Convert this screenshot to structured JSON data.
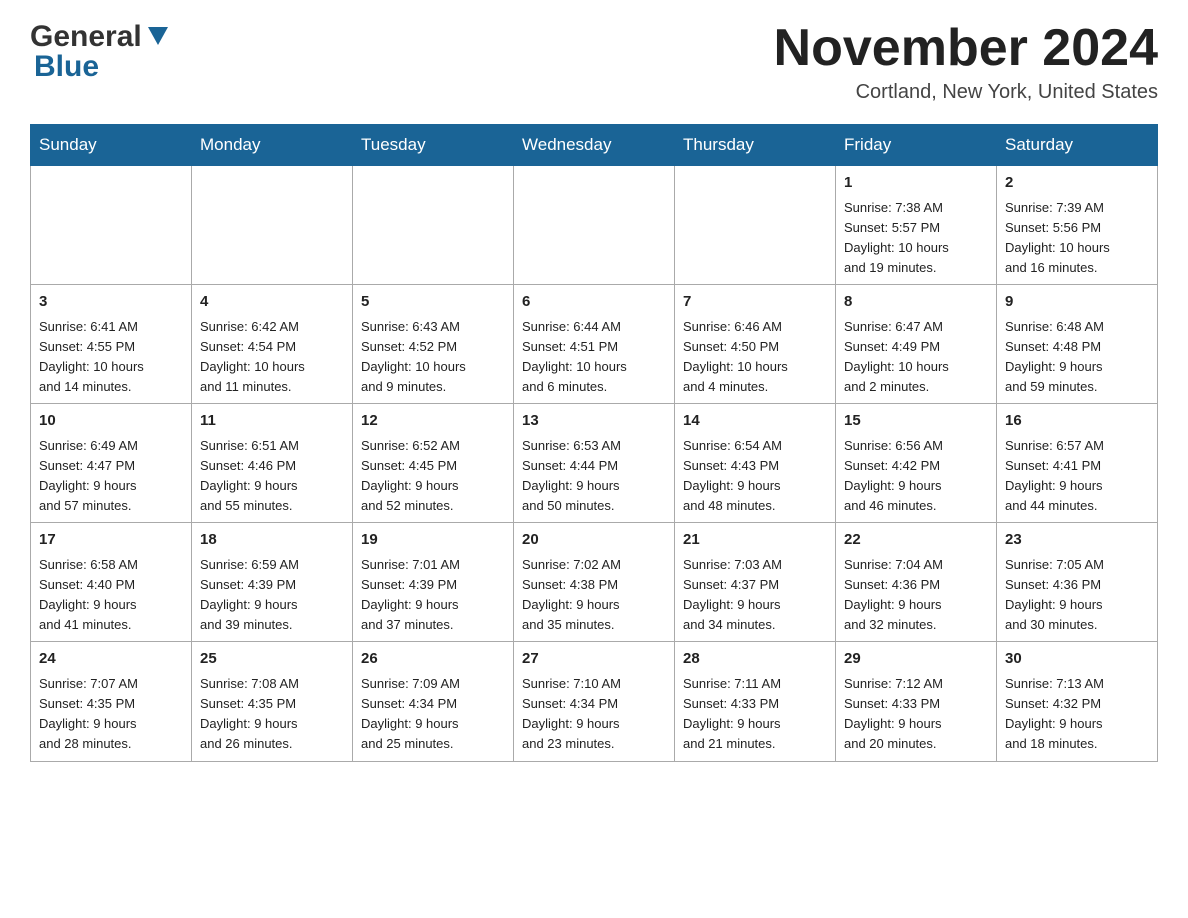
{
  "logo": {
    "line1": "General",
    "line2": "Blue"
  },
  "title": "November 2024",
  "location": "Cortland, New York, United States",
  "weekdays": [
    "Sunday",
    "Monday",
    "Tuesday",
    "Wednesday",
    "Thursday",
    "Friday",
    "Saturday"
  ],
  "weeks": [
    [
      {
        "day": "",
        "info": ""
      },
      {
        "day": "",
        "info": ""
      },
      {
        "day": "",
        "info": ""
      },
      {
        "day": "",
        "info": ""
      },
      {
        "day": "",
        "info": ""
      },
      {
        "day": "1",
        "info": "Sunrise: 7:38 AM\nSunset: 5:57 PM\nDaylight: 10 hours\nand 19 minutes."
      },
      {
        "day": "2",
        "info": "Sunrise: 7:39 AM\nSunset: 5:56 PM\nDaylight: 10 hours\nand 16 minutes."
      }
    ],
    [
      {
        "day": "3",
        "info": "Sunrise: 6:41 AM\nSunset: 4:55 PM\nDaylight: 10 hours\nand 14 minutes."
      },
      {
        "day": "4",
        "info": "Sunrise: 6:42 AM\nSunset: 4:54 PM\nDaylight: 10 hours\nand 11 minutes."
      },
      {
        "day": "5",
        "info": "Sunrise: 6:43 AM\nSunset: 4:52 PM\nDaylight: 10 hours\nand 9 minutes."
      },
      {
        "day": "6",
        "info": "Sunrise: 6:44 AM\nSunset: 4:51 PM\nDaylight: 10 hours\nand 6 minutes."
      },
      {
        "day": "7",
        "info": "Sunrise: 6:46 AM\nSunset: 4:50 PM\nDaylight: 10 hours\nand 4 minutes."
      },
      {
        "day": "8",
        "info": "Sunrise: 6:47 AM\nSunset: 4:49 PM\nDaylight: 10 hours\nand 2 minutes."
      },
      {
        "day": "9",
        "info": "Sunrise: 6:48 AM\nSunset: 4:48 PM\nDaylight: 9 hours\nand 59 minutes."
      }
    ],
    [
      {
        "day": "10",
        "info": "Sunrise: 6:49 AM\nSunset: 4:47 PM\nDaylight: 9 hours\nand 57 minutes."
      },
      {
        "day": "11",
        "info": "Sunrise: 6:51 AM\nSunset: 4:46 PM\nDaylight: 9 hours\nand 55 minutes."
      },
      {
        "day": "12",
        "info": "Sunrise: 6:52 AM\nSunset: 4:45 PM\nDaylight: 9 hours\nand 52 minutes."
      },
      {
        "day": "13",
        "info": "Sunrise: 6:53 AM\nSunset: 4:44 PM\nDaylight: 9 hours\nand 50 minutes."
      },
      {
        "day": "14",
        "info": "Sunrise: 6:54 AM\nSunset: 4:43 PM\nDaylight: 9 hours\nand 48 minutes."
      },
      {
        "day": "15",
        "info": "Sunrise: 6:56 AM\nSunset: 4:42 PM\nDaylight: 9 hours\nand 46 minutes."
      },
      {
        "day": "16",
        "info": "Sunrise: 6:57 AM\nSunset: 4:41 PM\nDaylight: 9 hours\nand 44 minutes."
      }
    ],
    [
      {
        "day": "17",
        "info": "Sunrise: 6:58 AM\nSunset: 4:40 PM\nDaylight: 9 hours\nand 41 minutes."
      },
      {
        "day": "18",
        "info": "Sunrise: 6:59 AM\nSunset: 4:39 PM\nDaylight: 9 hours\nand 39 minutes."
      },
      {
        "day": "19",
        "info": "Sunrise: 7:01 AM\nSunset: 4:39 PM\nDaylight: 9 hours\nand 37 minutes."
      },
      {
        "day": "20",
        "info": "Sunrise: 7:02 AM\nSunset: 4:38 PM\nDaylight: 9 hours\nand 35 minutes."
      },
      {
        "day": "21",
        "info": "Sunrise: 7:03 AM\nSunset: 4:37 PM\nDaylight: 9 hours\nand 34 minutes."
      },
      {
        "day": "22",
        "info": "Sunrise: 7:04 AM\nSunset: 4:36 PM\nDaylight: 9 hours\nand 32 minutes."
      },
      {
        "day": "23",
        "info": "Sunrise: 7:05 AM\nSunset: 4:36 PM\nDaylight: 9 hours\nand 30 minutes."
      }
    ],
    [
      {
        "day": "24",
        "info": "Sunrise: 7:07 AM\nSunset: 4:35 PM\nDaylight: 9 hours\nand 28 minutes."
      },
      {
        "day": "25",
        "info": "Sunrise: 7:08 AM\nSunset: 4:35 PM\nDaylight: 9 hours\nand 26 minutes."
      },
      {
        "day": "26",
        "info": "Sunrise: 7:09 AM\nSunset: 4:34 PM\nDaylight: 9 hours\nand 25 minutes."
      },
      {
        "day": "27",
        "info": "Sunrise: 7:10 AM\nSunset: 4:34 PM\nDaylight: 9 hours\nand 23 minutes."
      },
      {
        "day": "28",
        "info": "Sunrise: 7:11 AM\nSunset: 4:33 PM\nDaylight: 9 hours\nand 21 minutes."
      },
      {
        "day": "29",
        "info": "Sunrise: 7:12 AM\nSunset: 4:33 PM\nDaylight: 9 hours\nand 20 minutes."
      },
      {
        "day": "30",
        "info": "Sunrise: 7:13 AM\nSunset: 4:32 PM\nDaylight: 9 hours\nand 18 minutes."
      }
    ]
  ]
}
